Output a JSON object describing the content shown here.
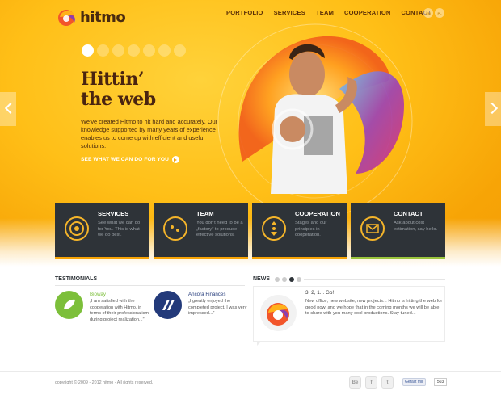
{
  "brand": {
    "name": "hitmo"
  },
  "nav": {
    "items": [
      "PORTFOLIO",
      "SERVICES",
      "TEAM",
      "COOPERATION",
      "CONTACT"
    ]
  },
  "languages": [
    "EN",
    "PL"
  ],
  "hero": {
    "icon_tabs": [
      "home-icon",
      "globe-icon",
      "grid-icon",
      "search-icon",
      "leaf-icon",
      "bag-icon",
      "house-icon"
    ],
    "headline_line1": "Hittin’",
    "headline_line2": "the web",
    "lead": "We've created Hitmo to hit hard and accurately. Our knowledge supported by many years of experience enables us to come up with efficient and useful solutions.",
    "cta": "SEE WHAT WE CAN DO FOR YOU"
  },
  "features": [
    {
      "title": "SERVICES",
      "text": "See what we can do for You. This is what we do best.",
      "icon": "spiral-icon"
    },
    {
      "title": "TEAM",
      "text": "You don't need to be a „factory” to produce effective solutions.",
      "icon": "face-icon"
    },
    {
      "title": "COOPERATION",
      "text": "Stages and our principles in cooperation.",
      "icon": "arrows-icon"
    },
    {
      "title": "CONTACT",
      "text": "Ask about cost estimation, say hello.",
      "icon": "envelope-icon"
    }
  ],
  "testimonials": {
    "title": "TESTIMONIALS",
    "items": [
      {
        "name": "Bioway",
        "quote": "„I am satisfied with the cooperation with Hitmo, in terms of their professionalism during project realization...”"
      },
      {
        "name": "Ancora Finances",
        "quote": "„I greatly enjoyed the completed project. I was very impressed...”"
      }
    ]
  },
  "news": {
    "title": "NEWS",
    "headline": "3, 2, 1... Go!",
    "text": "New office, new website, new projects... Hitmo is hitting the web for good now, and we hope that in the coming months we will be able to share with you many cool productions. Stay tuned..."
  },
  "footer": {
    "copyright": "copyright © 2009 - 2012 hitmo - All rights reserved.",
    "social": [
      "Be",
      "f",
      "t"
    ],
    "like_label": "Gefällt mir",
    "like_count": "503"
  },
  "colors": {
    "accent": "#f7a406",
    "dark": "#2e3338",
    "green": "#7cbf3a",
    "navy": "#233a7a"
  }
}
